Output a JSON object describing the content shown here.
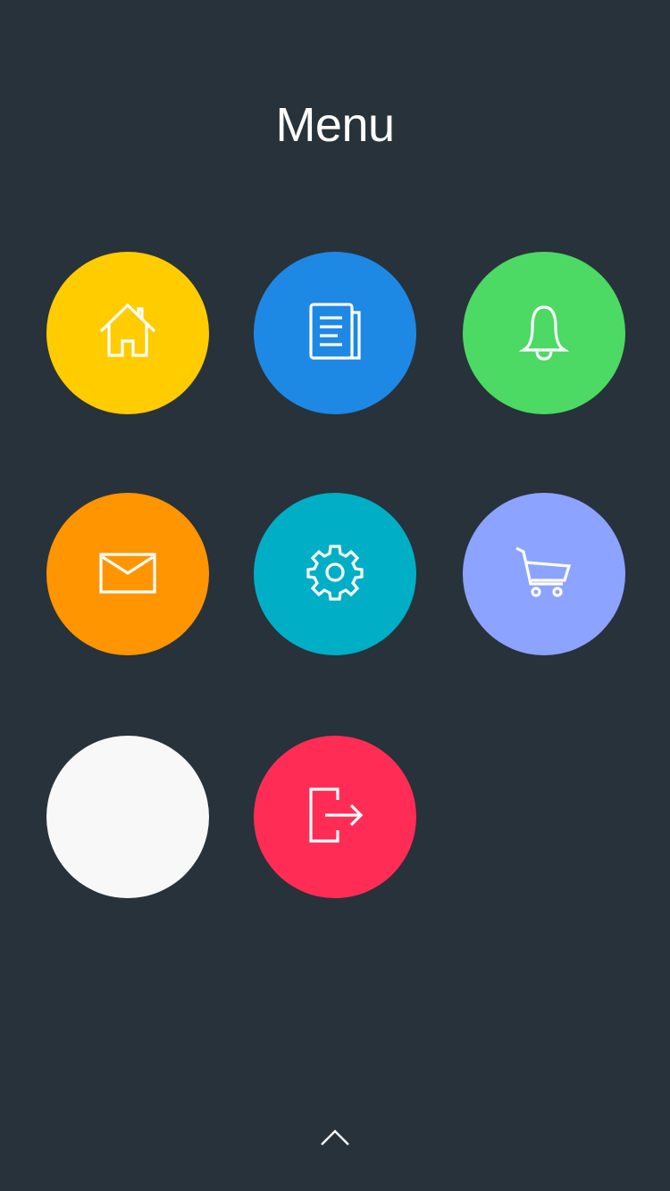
{
  "header": {
    "title": "Menu"
  },
  "menu": {
    "items": [
      {
        "key": "home",
        "icon": "home-icon",
        "color": "#ffcc00"
      },
      {
        "key": "news",
        "icon": "newspaper-icon",
        "color": "#1e88e5"
      },
      {
        "key": "notifications",
        "icon": "bell-icon",
        "color": "#4cd964"
      },
      {
        "key": "mail",
        "icon": "envelope-icon",
        "color": "#ff9500"
      },
      {
        "key": "settings",
        "icon": "gear-icon",
        "color": "#00aec6"
      },
      {
        "key": "cart",
        "icon": "shopping-cart-icon",
        "color": "#8ca3ff"
      },
      {
        "key": "blank",
        "icon": "",
        "color": "#f8f8f8"
      },
      {
        "key": "logout",
        "icon": "logout-icon",
        "color": "#ff2d55"
      }
    ]
  },
  "footer": {
    "collapse_icon": "chevron-up-icon"
  }
}
